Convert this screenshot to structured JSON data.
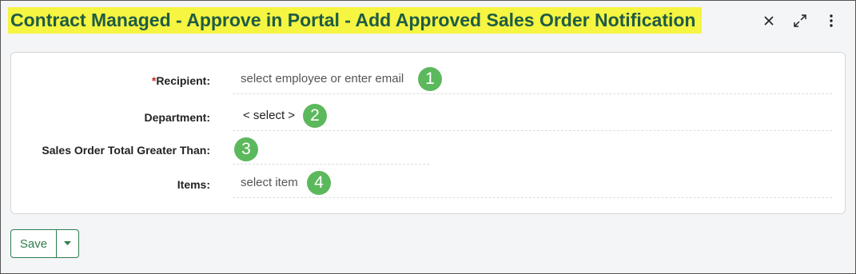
{
  "dialog": {
    "title": "Contract Managed - Approve in Portal - Add Approved Sales Order Notification"
  },
  "window_controls": [
    "close-icon",
    "expand-icon",
    "more-vertical-icon"
  ],
  "form": {
    "recipient": {
      "required_mark": "*",
      "label": "Recipient:",
      "placeholder": "select employee or enter email",
      "badge": "1"
    },
    "department": {
      "label": "Department:",
      "value": "< select >",
      "badge": "2"
    },
    "sales_order_total": {
      "label": "Sales Order Total Greater Than:",
      "value": "",
      "badge": "3"
    },
    "items": {
      "label": "Items:",
      "placeholder": "select item",
      "badge": "4"
    }
  },
  "footer": {
    "save_label": "Save",
    "dropdown_icon": "caret-down-icon"
  },
  "colors": {
    "title_highlight": "#f5f542",
    "title_text": "#1f5c45",
    "badge": "#5cb85c",
    "accent": "#2e7d4f",
    "required": "#c62828"
  }
}
